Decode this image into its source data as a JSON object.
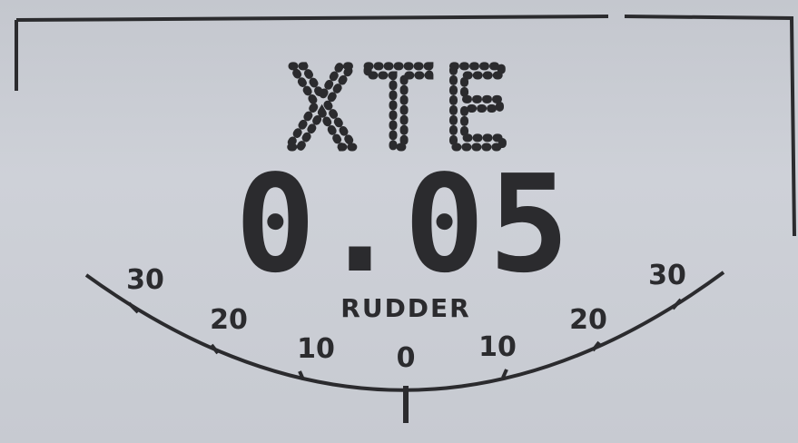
{
  "display": {
    "mode_label": "XTE",
    "value": "0.05",
    "scale_label": "RUDDER",
    "colors": {
      "background": "#c9ccd3",
      "ink": "#2b2b2e"
    },
    "ticks": [
      {
        "label": "30",
        "side": "left"
      },
      {
        "label": "20",
        "side": "left"
      },
      {
        "label": "10",
        "side": "left"
      },
      {
        "label": "0",
        "side": "center"
      },
      {
        "label": "10",
        "side": "right"
      },
      {
        "label": "20",
        "side": "right"
      },
      {
        "label": "30",
        "side": "right"
      }
    ],
    "rudder_angle": 0
  }
}
